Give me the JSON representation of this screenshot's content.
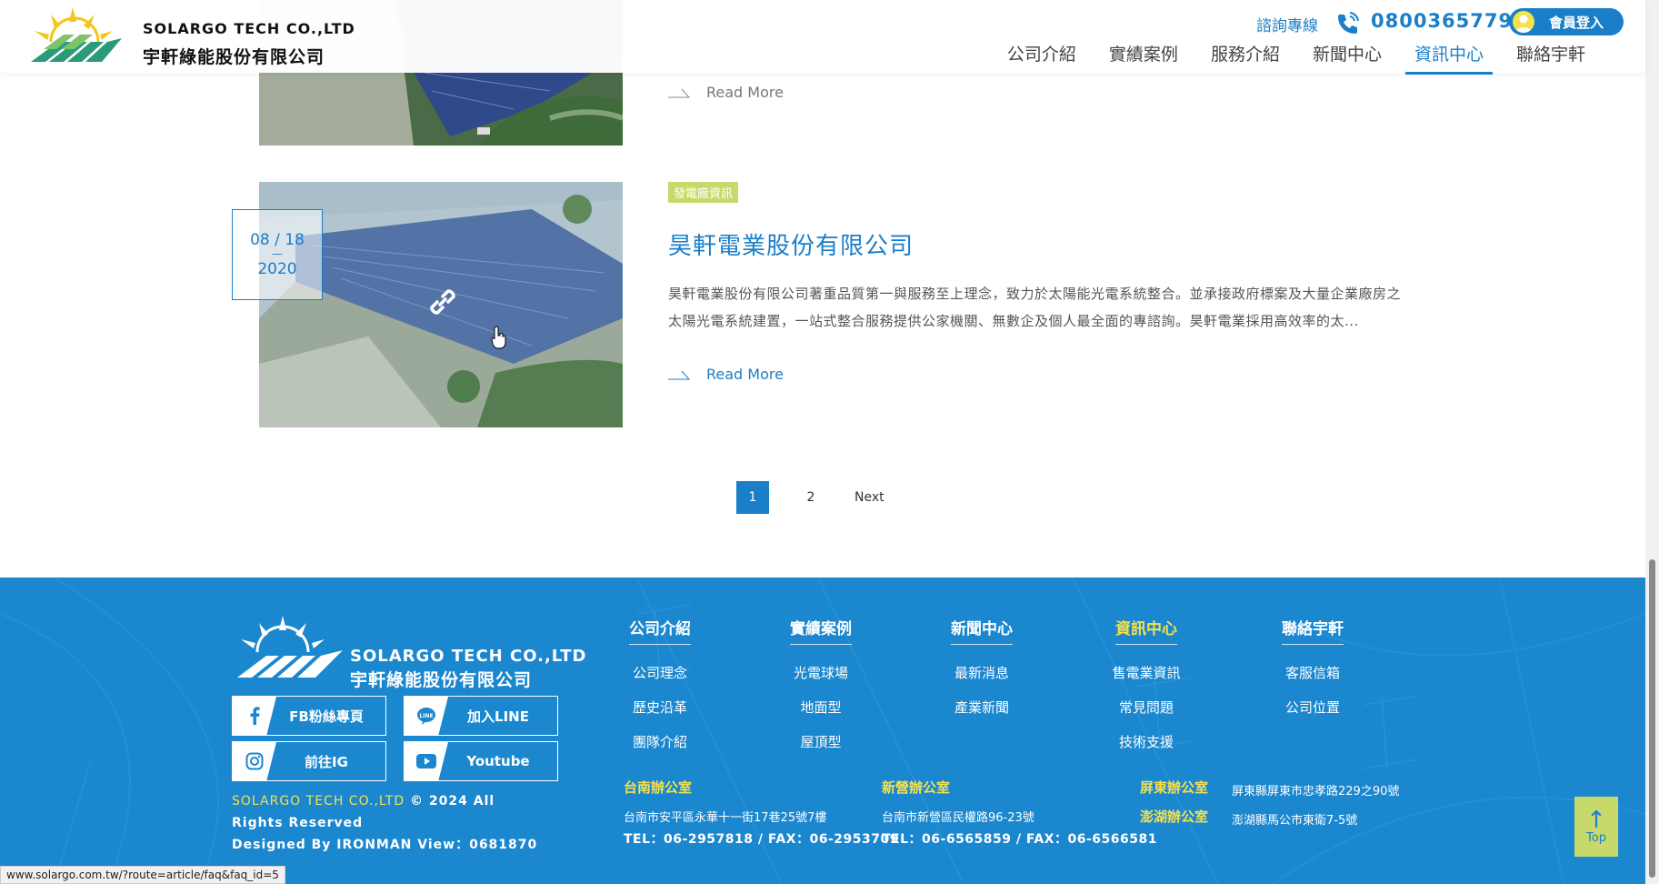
{
  "header": {
    "brand_en": "SOLARGO TECH CO.,LTD",
    "brand_zh": "宇軒綠能股份有限公司",
    "hotline_label": "諮詢專線",
    "hotline_number": "0800365779",
    "login_label": "會員登入",
    "nav": [
      "公司介紹",
      "實績案例",
      "服務介紹",
      "新聞中心",
      "資訊中心",
      "聯絡宇軒"
    ],
    "nav_active": "資訊中心"
  },
  "articles": {
    "prev_readmore": "Read More",
    "main": {
      "date_md": "08 / 18",
      "date_sep": "—",
      "date_year": "2020",
      "tag": "發電廠資訊",
      "title": "昊軒電業股份有限公司",
      "excerpt": "昊軒電業股份有限公司著重品質第一與服務至上理念，致力於太陽能光電系統整合。並承接政府標案及大量企業廠房之太陽光電系統建置，一站式整合服務提供公家機關、無數企及個人最全面的專諮詢。昊軒電業採用高效率的太...",
      "readmore": "Read More"
    }
  },
  "pagination": {
    "pages": [
      "1",
      "2"
    ],
    "current": "1",
    "next": "Next"
  },
  "footer": {
    "brand_en": "SOLARGO TECH CO.,LTD",
    "brand_zh": "宇軒綠能股份有限公司",
    "social": {
      "fb": "FB粉絲專頁",
      "line": "加入LINE",
      "ig": "前往IG",
      "youtube": "Youtube"
    },
    "copyright_brand": "SOLARGO TECH CO.,LTD",
    "copyright_text": " © 2024 All Rights Reserved",
    "designed_by": "Designed By IRONMAN View：0681870",
    "columns": [
      {
        "title": "公司介紹",
        "links": [
          "公司理念",
          "歷史沿革",
          "團隊介紹"
        ]
      },
      {
        "title": "實績案例",
        "links": [
          "光電球場",
          "地面型",
          "屋頂型"
        ]
      },
      {
        "title": "新聞中心",
        "links": [
          "最新消息",
          "產業新聞"
        ]
      },
      {
        "title": "資訊中心",
        "links": [
          "售電業資訊",
          "常見問題",
          "技術支援"
        ]
      },
      {
        "title": "聯絡宇軒",
        "links": [
          "客服信箱",
          "公司位置"
        ]
      }
    ],
    "offices": {
      "tainan": {
        "label": "台南辦公室",
        "address": "台南市安平區永華十一街17巷25號7樓",
        "tel": "TEL：06-2957818  /  FAX：06-2953709"
      },
      "xinying": {
        "label": "新營辦公室",
        "address": "台南市新營區民權路96-23號",
        "tel": "TEL：06-6565859  /  FAX：06-6566581"
      },
      "pingtung": {
        "label": "屏東辦公室",
        "address": "屏東縣屏東市忠孝路229之90號"
      },
      "penghu": {
        "label": "澎湖辦公室",
        "address": "澎湖縣馬公市東衛7-5號"
      }
    }
  },
  "top_button": {
    "arrow": "↑",
    "label": "Top"
  },
  "status_url": "www.solargo.com.tw/?route=article/faq&faq_id=5",
  "colors": {
    "primary": "#1a7fc8",
    "footer_bg": "#1a87cf",
    "accent_yellow": "#f5e04d",
    "tag_green": "#c8d96c"
  }
}
